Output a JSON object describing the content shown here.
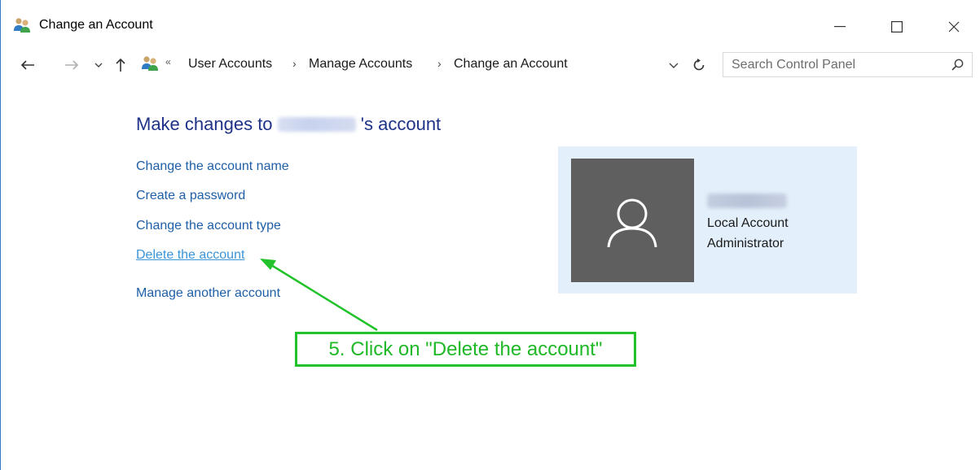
{
  "window": {
    "title": "Change an Account",
    "icon": "user-accounts-icon"
  },
  "window_controls": [
    "minimize",
    "maximize",
    "close"
  ],
  "navigation": {
    "back": "back-arrow-icon",
    "forward": "forward-arrow-icon",
    "recent": "chevron-down-icon",
    "up": "up-arrow-icon"
  },
  "address_bar": {
    "overflow": "«",
    "breadcrumbs": [
      "User Accounts",
      "Manage Accounts",
      "Change an Account"
    ],
    "separator": "›"
  },
  "search": {
    "placeholder": "Search Control Panel"
  },
  "main": {
    "heading_prefix": "Make changes to",
    "heading_suffix": "'s account",
    "links": [
      "Change the account name",
      "Create a password",
      "Change the account type",
      "Delete the account",
      "Manage another account"
    ]
  },
  "account_card": {
    "account_type": "Local Account",
    "role": "Administrator"
  },
  "annotation": {
    "text": "5. Click on \"Delete the account\"",
    "color": "#22c22a"
  },
  "colors": {
    "heading": "#1e3287",
    "link": "#1e5fa8",
    "link_hover": "#3a95d8",
    "card_bg": "#e3f0fb",
    "avatar_bg": "#5f5f5f"
  }
}
